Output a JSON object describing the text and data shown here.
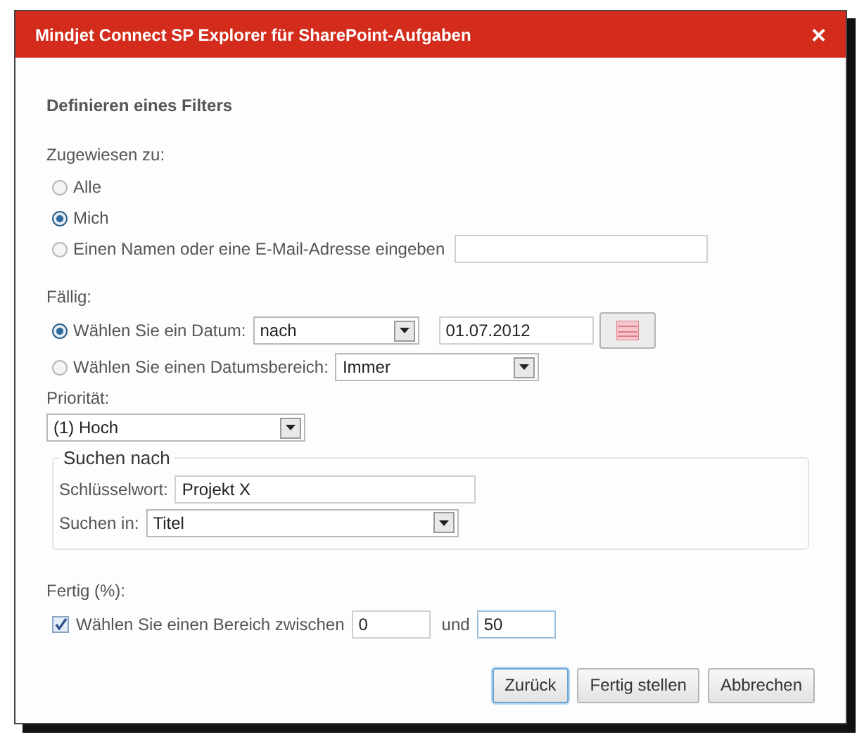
{
  "window": {
    "title": "Mindjet Connect SP Explorer für SharePoint-Aufgaben",
    "close": "×"
  },
  "heading": "Definieren eines Filters",
  "assigned": {
    "label": "Zugewiesen zu:",
    "options": [
      {
        "label": "Alle",
        "selected": false
      },
      {
        "label": "Mich",
        "selected": true
      },
      {
        "label": "Einen Namen oder eine E-Mail-Adresse eingeben",
        "selected": false,
        "kind": "input"
      }
    ]
  },
  "due": {
    "label": "Fällig:",
    "options": [
      {
        "label": "Wählen Sie ein Datum:",
        "selected": true,
        "kind": "date",
        "select": "nach",
        "date": "01.07.2012"
      },
      {
        "label": "Wählen Sie einen Datumsbereich:",
        "selected": false,
        "kind": "range",
        "select": "Immer"
      }
    ]
  },
  "priority": {
    "label": "Priorität:",
    "value": "(1) Hoch"
  },
  "search": {
    "legend": "Suchen nach",
    "keyword_label": "Schlüsselwort:",
    "keyword": "Projekt X",
    "in_label": "Suchen in:",
    "in_value": "Titel"
  },
  "complete": {
    "label": "Fertig (%):",
    "checkbox": {
      "label": "Wählen Sie einen Bereich zwischen",
      "checked": true
    },
    "from": "0",
    "and": "und",
    "to": "50"
  },
  "buttons": [
    {
      "label": "Zurück",
      "selected": true
    },
    {
      "label": "Fertig stellen",
      "selected": false
    },
    {
      "label": "Abbrechen",
      "selected": false
    }
  ]
}
